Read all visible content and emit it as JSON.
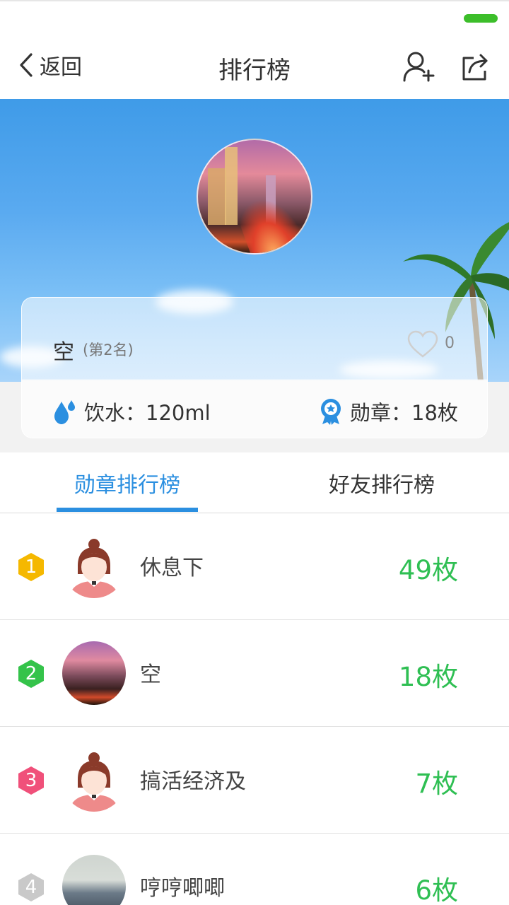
{
  "header": {
    "back_label": "返回",
    "title": "排行榜",
    "add_friend_icon": "add-user-icon",
    "share_icon": "share-icon"
  },
  "profile": {
    "name": "空",
    "rank_text": "(第2名)",
    "likes": "0",
    "water": "饮水：120ml",
    "medals": "勋章：18枚"
  },
  "tabs": [
    {
      "label": "勋章排行榜",
      "active": true
    },
    {
      "label": "好友排行榜",
      "active": false
    }
  ],
  "ranking": [
    {
      "rank": "1",
      "name": "休息下",
      "count": "49枚",
      "badge_color": "#f5b800",
      "avatar": "girl"
    },
    {
      "rank": "2",
      "name": "空",
      "count": "18枚",
      "badge_color": "#34c34a",
      "avatar": "city"
    },
    {
      "rank": "3",
      "name": "搞活经济及",
      "count": "7枚",
      "badge_color": "#f0507a",
      "avatar": "girl"
    },
    {
      "rank": "4",
      "name": "哼哼唧唧",
      "count": "6枚",
      "badge_color": "#c9c9c9",
      "avatar": "photo"
    }
  ],
  "colors": {
    "accent": "#2b8fe0",
    "count_green": "#2fbf53",
    "status_green": "#3cbe2a"
  }
}
